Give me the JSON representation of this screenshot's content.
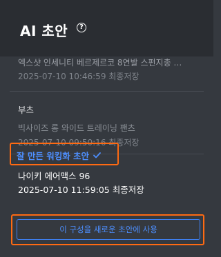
{
  "header": {
    "title": "AI 초안",
    "help_glyph": "?",
    "help_icon": "help-circle-icon"
  },
  "drafts": [
    {
      "name": "엑스샷 인세니티 베르제르코 8연발 스펀지총 …",
      "date": "2025-07-10 10:46:59 최종저장"
    },
    {
      "name": "부츠",
      "subtitle": "빅사이즈 롱 와이드 트레이닝 팬츠",
      "date": "2025-07-10 09:50:16 최종저장"
    },
    {
      "name": "잘 만든 워킹화 초안",
      "subtitle": "나이키 에어맥스 96",
      "date": "2025-07-10 11:59:05 최종저장",
      "selected": true,
      "action_label": "이 구성을 새로운 초안에 사용"
    }
  ],
  "colors": {
    "accent": "#4d8fff",
    "highlight": "#ff6a12",
    "background": "#35393f",
    "header_bg": "#2a2d32"
  }
}
